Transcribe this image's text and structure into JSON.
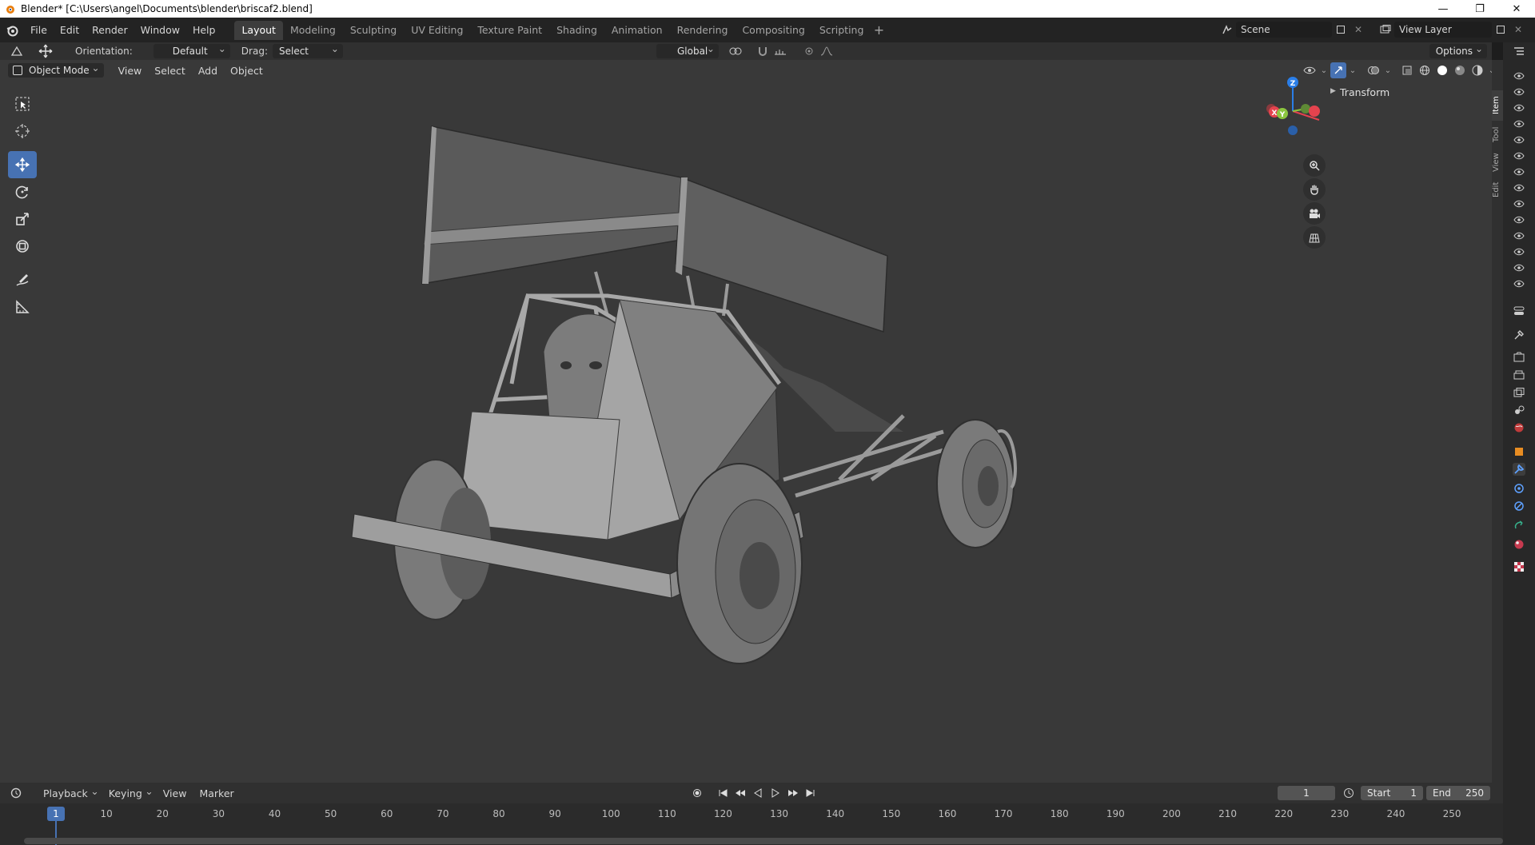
{
  "window": {
    "title": "Blender* [C:\\Users\\angel\\Documents\\blender\\briscaf2.blend]",
    "minimize": "—",
    "restore": "❐",
    "close": "✕"
  },
  "menus": [
    "File",
    "Edit",
    "Render",
    "Window",
    "Help"
  ],
  "workspaces": [
    "Layout",
    "Modeling",
    "Sculpting",
    "UV Editing",
    "Texture Paint",
    "Shading",
    "Animation",
    "Rendering",
    "Compositing",
    "Scripting"
  ],
  "active_workspace": "Layout",
  "scene": {
    "name": "Scene"
  },
  "view_layer": {
    "name": "View Layer"
  },
  "tool_header": {
    "orientation_label": "Orientation:",
    "orientation_value": "Default",
    "drag_label": "Drag:",
    "drag_value": "Select Box",
    "transform_orientation": "Global",
    "options_label": "Options"
  },
  "viewport_header": {
    "mode": "Object Mode",
    "menus": [
      "View",
      "Select",
      "Add",
      "Object"
    ]
  },
  "npanel": {
    "section": "Transform",
    "tabs": [
      "Item",
      "Tool",
      "View",
      "Edit"
    ]
  },
  "gizmo": {
    "z": "Z",
    "y": "Y",
    "x": "X"
  },
  "timeline": {
    "menus": [
      "Playback",
      "Keying",
      "View",
      "Marker"
    ],
    "current_frame": "1",
    "start_label": "Start",
    "start_value": "1",
    "end_label": "End",
    "end_value": "250",
    "ticks": [
      "10",
      "20",
      "30",
      "40",
      "50",
      "60",
      "70",
      "80",
      "90",
      "100",
      "110",
      "120",
      "130",
      "140",
      "150",
      "160",
      "170",
      "180",
      "190",
      "200",
      "210",
      "220",
      "230",
      "240",
      "250"
    ],
    "cursor_frame": "1"
  },
  "colors": {
    "accent": "#4772b3",
    "viewport_bg": "#393939",
    "axis_x": "#e5434e",
    "axis_y": "#8cc63f",
    "axis_z": "#2a7ee8"
  }
}
